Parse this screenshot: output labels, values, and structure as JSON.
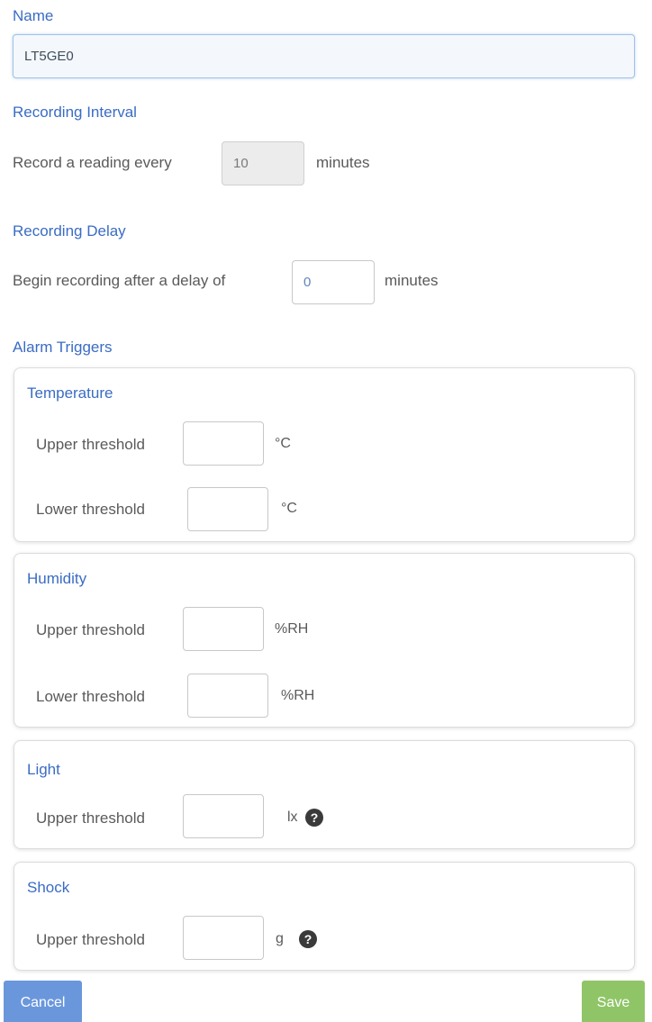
{
  "name": {
    "label": "Name",
    "value": "LT5GE0"
  },
  "recording_interval": {
    "heading": "Recording Interval",
    "prefix": "Record a reading every",
    "value": "10",
    "unit": "minutes"
  },
  "recording_delay": {
    "heading": "Recording Delay",
    "prefix": "Begin recording after a delay of",
    "value": "0",
    "unit": "minutes"
  },
  "alarm_triggers": {
    "heading": "Alarm Triggers",
    "temperature": {
      "title": "Temperature",
      "upper_label": "Upper threshold",
      "upper_unit": "°C",
      "lower_label": "Lower threshold",
      "lower_unit": "°C"
    },
    "humidity": {
      "title": "Humidity",
      "upper_label": "Upper threshold",
      "upper_unit": "%RH",
      "lower_label": "Lower threshold",
      "lower_unit": "%RH"
    },
    "light": {
      "title": "Light",
      "upper_label": "Upper threshold",
      "upper_unit": "lx",
      "help_icon": "question-circle-icon"
    },
    "shock": {
      "title": "Shock",
      "upper_label": "Upper threshold",
      "upper_unit": "g",
      "help_icon": "question-circle-icon"
    }
  },
  "buttons": {
    "cancel": "Cancel",
    "save": "Save"
  },
  "colors": {
    "accent_blue": "#3a6cc4",
    "cancel_bg": "#6a97dc",
    "save_bg": "#8fc567"
  }
}
